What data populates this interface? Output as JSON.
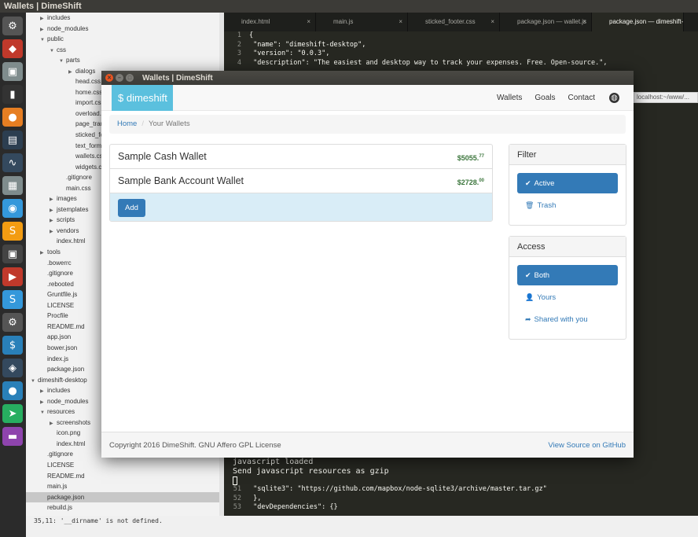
{
  "topbar": {
    "title": "Wallets | DimeShift"
  },
  "launcher": {
    "icons": [
      "⚙",
      "◆",
      "▣",
      "▮",
      "●",
      "▤",
      "∿",
      "▦",
      "◉",
      "S",
      "▣",
      "▶",
      "S",
      "⚙",
      "$",
      "◈",
      "●",
      "➤",
      "▬"
    ]
  },
  "tree": {
    "rows": [
      {
        "indent": 1,
        "arrow": "▶",
        "label": "includes"
      },
      {
        "indent": 1,
        "arrow": "▶",
        "label": "node_modules"
      },
      {
        "indent": 1,
        "arrow": "▼",
        "label": "public"
      },
      {
        "indent": 2,
        "arrow": "▼",
        "label": "css"
      },
      {
        "indent": 3,
        "arrow": "▼",
        "label": "parts"
      },
      {
        "indent": 4,
        "arrow": "▶",
        "label": "dialogs"
      },
      {
        "indent": 4,
        "arrow": "",
        "label": "head.css"
      },
      {
        "indent": 4,
        "arrow": "",
        "label": "home.css"
      },
      {
        "indent": 4,
        "arrow": "",
        "label": "import.css"
      },
      {
        "indent": 4,
        "arrow": "",
        "label": "overload.css"
      },
      {
        "indent": 4,
        "arrow": "",
        "label": "page_transitions.css"
      },
      {
        "indent": 4,
        "arrow": "",
        "label": "sticked_footer.css"
      },
      {
        "indent": 4,
        "arrow": "",
        "label": "text_formatting.css"
      },
      {
        "indent": 4,
        "arrow": "",
        "label": "wallets.css"
      },
      {
        "indent": 4,
        "arrow": "",
        "label": "widgets.css"
      },
      {
        "indent": 3,
        "arrow": "",
        "label": ".gitignore"
      },
      {
        "indent": 3,
        "arrow": "",
        "label": "main.css"
      },
      {
        "indent": 2,
        "arrow": "▶",
        "label": "images"
      },
      {
        "indent": 2,
        "arrow": "▶",
        "label": "jstemplates"
      },
      {
        "indent": 2,
        "arrow": "▶",
        "label": "scripts"
      },
      {
        "indent": 2,
        "arrow": "▶",
        "label": "vendors"
      },
      {
        "indent": 2,
        "arrow": "",
        "label": "index.html"
      },
      {
        "indent": 1,
        "arrow": "▶",
        "label": "tools"
      },
      {
        "indent": 1,
        "arrow": "",
        "label": ".bowerrc"
      },
      {
        "indent": 1,
        "arrow": "",
        "label": ".gitignore"
      },
      {
        "indent": 1,
        "arrow": "",
        "label": ".rebooted"
      },
      {
        "indent": 1,
        "arrow": "",
        "label": "Gruntfile.js"
      },
      {
        "indent": 1,
        "arrow": "",
        "label": "LICENSE"
      },
      {
        "indent": 1,
        "arrow": "",
        "label": "Procfile"
      },
      {
        "indent": 1,
        "arrow": "",
        "label": "README.md"
      },
      {
        "indent": 1,
        "arrow": "",
        "label": "app.json"
      },
      {
        "indent": 1,
        "arrow": "",
        "label": "bower.json"
      },
      {
        "indent": 1,
        "arrow": "",
        "label": "index.js"
      },
      {
        "indent": 1,
        "arrow": "",
        "label": "package.json"
      },
      {
        "indent": 0,
        "arrow": "▼",
        "label": "dimeshift-desktop"
      },
      {
        "indent": 1,
        "arrow": "▶",
        "label": "includes"
      },
      {
        "indent": 1,
        "arrow": "▶",
        "label": "node_modules"
      },
      {
        "indent": 1,
        "arrow": "▼",
        "label": "resources"
      },
      {
        "indent": 2,
        "arrow": "▶",
        "label": "screenshots"
      },
      {
        "indent": 2,
        "arrow": "",
        "label": "icon.png"
      },
      {
        "indent": 2,
        "arrow": "",
        "label": "index.html"
      },
      {
        "indent": 1,
        "arrow": "",
        "label": ".gitignore"
      },
      {
        "indent": 1,
        "arrow": "",
        "label": "LICENSE"
      },
      {
        "indent": 1,
        "arrow": "",
        "label": "README.md"
      },
      {
        "indent": 1,
        "arrow": "",
        "label": "main.js"
      },
      {
        "indent": 1,
        "arrow": "",
        "label": "package.json",
        "selected": true
      },
      {
        "indent": 1,
        "arrow": "",
        "label": "rebuild.js"
      }
    ]
  },
  "editor": {
    "tabs": [
      {
        "label": "index.html",
        "active": false
      },
      {
        "label": "main.js",
        "active": false
      },
      {
        "label": "sticked_footer.css",
        "active": false
      },
      {
        "label": "package.json — wallet.js",
        "active": false
      },
      {
        "label": "package.json — dimeshift-desktop",
        "active": true
      }
    ],
    "code_top": [
      {
        "n": "1",
        "text": "{"
      },
      {
        "n": "2",
        "text": "  \"name\": \"dimeshift-desktop\","
      },
      {
        "n": "3",
        "text": "  \"version\": \"0.0.3\","
      },
      {
        "n": "4",
        "text": "  \"description\": \"The easiest and desktop way to track your expenses. Free. Open-source.\","
      }
    ],
    "code_bottom": [
      {
        "n": "51",
        "text": "    \"sqlite3\": \"https://github.com/mapbox/node-sqlite3/archive/master.tar.gz\""
      },
      {
        "n": "52",
        "text": "  },"
      },
      {
        "n": "53",
        "text": "  \"devDependencies\": {}"
      }
    ],
    "url_fragment": "localhost:~/www/..."
  },
  "terminal": {
    "lines": [
      "javascript loaded",
      "Send javascript resources as gzip"
    ]
  },
  "bottom_log": {
    "text": "35,11: '__dirname' is not defined."
  },
  "app": {
    "window_title": "Wallets | DimeShift",
    "brand": "$ dimeshift",
    "nav": {
      "wallets": "Wallets",
      "goals": "Goals",
      "contact": "Contact"
    },
    "breadcrumb": {
      "home": "Home",
      "current": "Your Wallets"
    },
    "wallets": [
      {
        "name": "Sample Cash Wallet",
        "amount": "$5055.",
        "cents": "77"
      },
      {
        "name": "Sample Bank Account Wallet",
        "amount": "$2728.",
        "cents": "00"
      }
    ],
    "add_label": "Add",
    "filter": {
      "title": "Filter",
      "active": "Active",
      "trash": "Trash"
    },
    "access": {
      "title": "Access",
      "both": "Both",
      "yours": "Yours",
      "shared": "Shared with you"
    },
    "footer": {
      "copyright": "Copyright 2016 DimeShift. GNU Affero GPL License",
      "github": "View Source on GitHub"
    },
    "colors": {
      "brand": "#5bc0de",
      "primary": "#337ab7",
      "amount": "#3c763d"
    }
  }
}
